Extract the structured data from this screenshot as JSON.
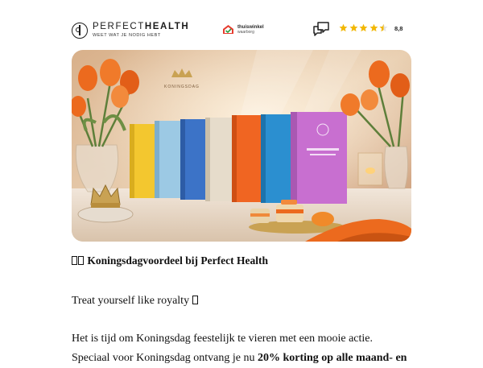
{
  "brand": {
    "name_light": "PERFECT",
    "name_bold": "HEALTH",
    "slogan": "WEET WAT JE NODIG HEBT"
  },
  "trust": {
    "line1": "thuiswinkel",
    "line2": "waarborg"
  },
  "rating": {
    "stars": 4.5,
    "score": "8,8",
    "star_color": "#f2b705"
  },
  "hero": {
    "box_label": "KONINGSDAG"
  },
  "email": {
    "heading": "Koningsdagvoordeel bij Perfect Health",
    "tagline": "Treat yourself like royalty",
    "paragraph_start": "Het is tijd om Koningsdag feestelijk te vieren met een mooie actie. Speciaal voor Koningsdag ontvang je nu ",
    "paragraph_bold": "20% korting op alle maand- en"
  },
  "colors": {
    "accent_orange": "#ec6a1e",
    "text": "#111111"
  }
}
